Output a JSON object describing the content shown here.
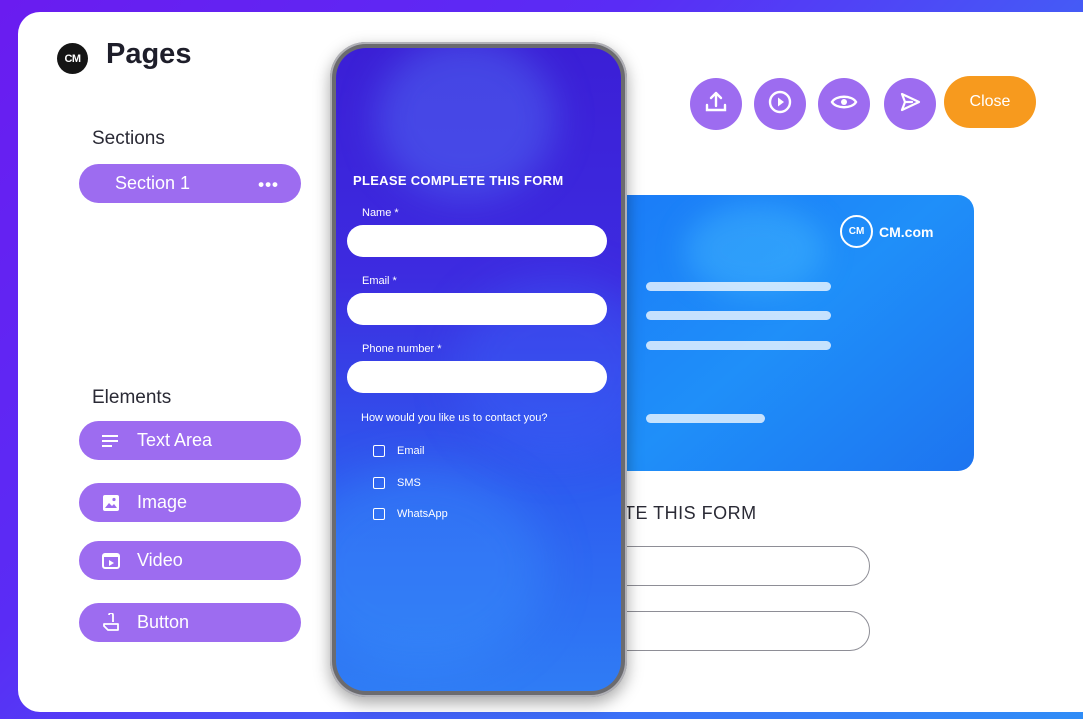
{
  "app": {
    "logo_text": "CM",
    "title": "Pages"
  },
  "sections": {
    "heading": "Sections",
    "items": [
      {
        "label": "Section 1",
        "menu": "•••"
      }
    ]
  },
  "elements": {
    "heading": "Elements",
    "items": [
      {
        "label": "Text Area",
        "icon": "text-area-icon"
      },
      {
        "label": "Image",
        "icon": "image-icon"
      },
      {
        "label": "Video",
        "icon": "video-icon"
      },
      {
        "label": "Button",
        "icon": "button-pointer-icon"
      }
    ]
  },
  "toolbar": {
    "buttons": [
      "upload-icon",
      "play-icon",
      "eye-icon",
      "send-icon"
    ],
    "close_label": "Close",
    "accent": "#9d6cf0",
    "close_color": "#f79a1e"
  },
  "preview_card": {
    "brand": "CM.com",
    "logo_text": "CM"
  },
  "back_form": {
    "title_fragment": "IETE THIS FORM"
  },
  "phone_form": {
    "title": "PLEASE COMPLETE THIS FORM",
    "fields": [
      {
        "label": "Name *",
        "value": ""
      },
      {
        "label": "Email *",
        "value": ""
      },
      {
        "label": "Phone number *",
        "value": ""
      }
    ],
    "question": "How would you like us to contact you?",
    "options": [
      "Email",
      "SMS",
      "WhatsApp"
    ]
  }
}
